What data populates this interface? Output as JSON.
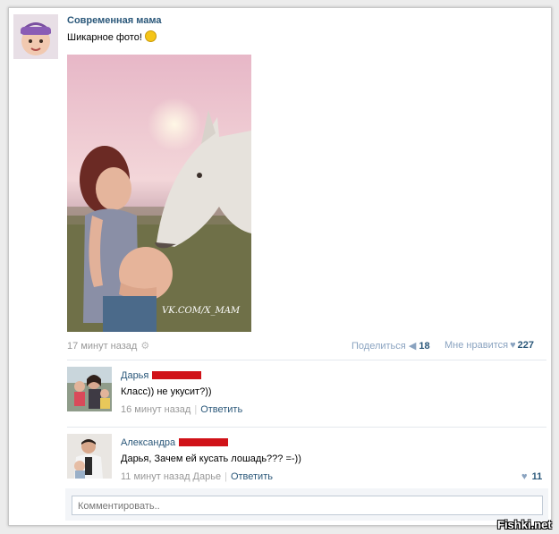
{
  "post": {
    "author": "Современная мама",
    "text": "Шикарное фото!",
    "emoji_icon": "grinning-smiley-icon",
    "photo_watermark": "VK.COM/X_MAM",
    "time": "17 минут назад",
    "share_label": "Поделиться",
    "share_count": "18",
    "like_label": "Мне нравится",
    "like_count": "227"
  },
  "comments": [
    {
      "author": "Дарья",
      "text": "Класс)) не укусит?))",
      "time": "16 минут назад",
      "reply_label": "Ответить"
    },
    {
      "author": "Александра",
      "text": "Дарья, Зачем ей кусать лошадь??? =-))",
      "time": "11 минут назад Дарье",
      "reply_label": "Ответить",
      "like_count": "11"
    }
  ],
  "comment_input": {
    "placeholder": "Комментировать.."
  },
  "site_watermark": "Fishki.net",
  "colors": {
    "link": "#2b587a",
    "meta": "#999999",
    "redaction": "#d01218"
  }
}
